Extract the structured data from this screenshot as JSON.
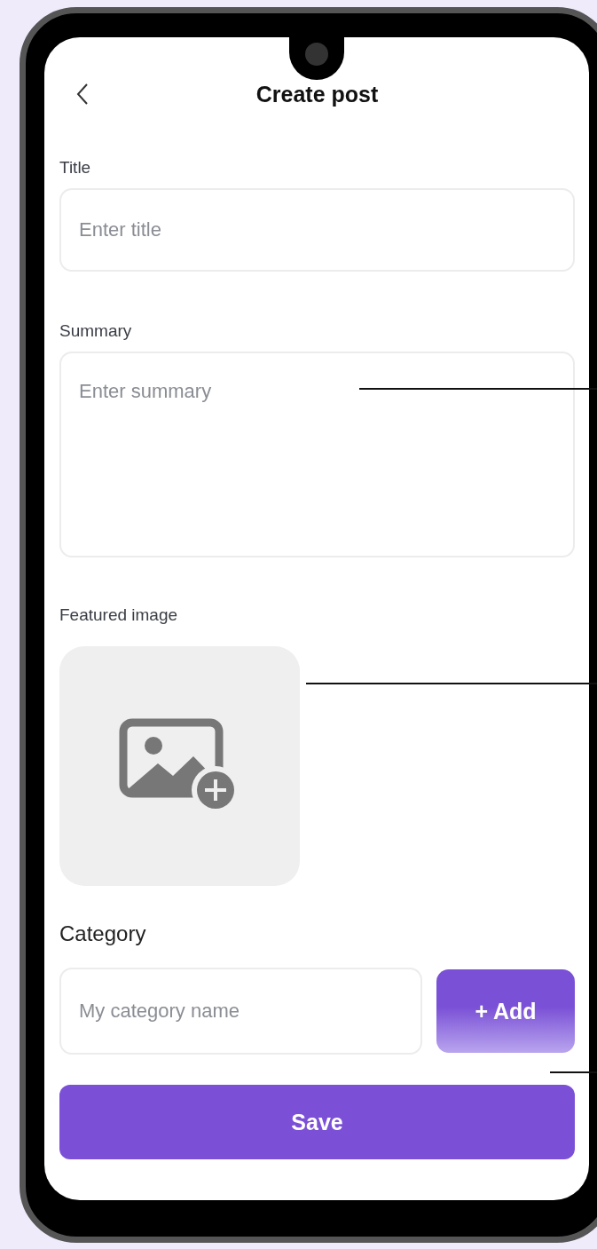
{
  "header": {
    "title": "Create post"
  },
  "fields": [
    {
      "kind": "input",
      "label": "Title",
      "placeholder": "Enter title"
    },
    {
      "kind": "textarea",
      "label": "Summary",
      "placeholder": "Enter summary"
    }
  ],
  "featured_image": {
    "label": "Featured image"
  },
  "category": {
    "label": "Category",
    "placeholder": "My category name",
    "add_button": "+ Add"
  },
  "save_button": "Save"
}
